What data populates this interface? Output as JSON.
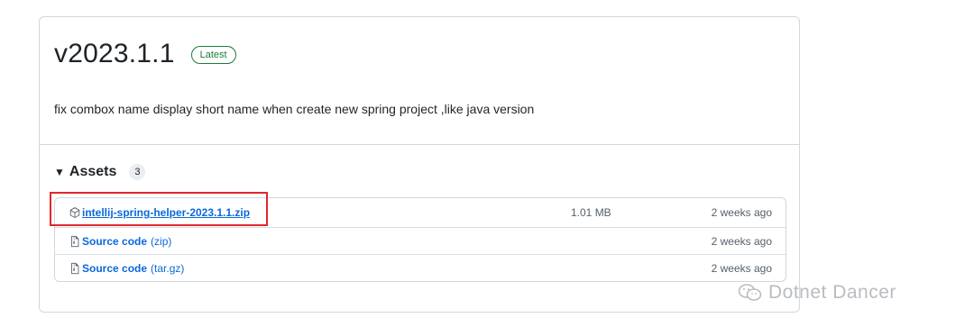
{
  "release": {
    "version": "v2023.1.1",
    "badge": "Latest",
    "notes": "fix combox name display short name when create new spring project ,like java version"
  },
  "assets": {
    "title": "Assets",
    "count": "3",
    "items": [
      {
        "name": "intellij-spring-helper-2023.1.1.zip",
        "ext": "",
        "size": "1.01 MB",
        "date": "2 weeks ago",
        "icon": "package-icon"
      },
      {
        "name": "Source code",
        "ext": "(zip)",
        "size": "",
        "date": "2 weeks ago",
        "icon": "file-zip-icon"
      },
      {
        "name": "Source code",
        "ext": "(tar.gz)",
        "size": "",
        "date": "2 weeks ago",
        "icon": "file-zip-icon"
      }
    ]
  },
  "watermark": {
    "text": "Dotnet Dancer"
  },
  "colors": {
    "link": "#0969da",
    "latest": "#1a7f37",
    "highlight": "#e2272c",
    "border": "#d0d7de"
  }
}
